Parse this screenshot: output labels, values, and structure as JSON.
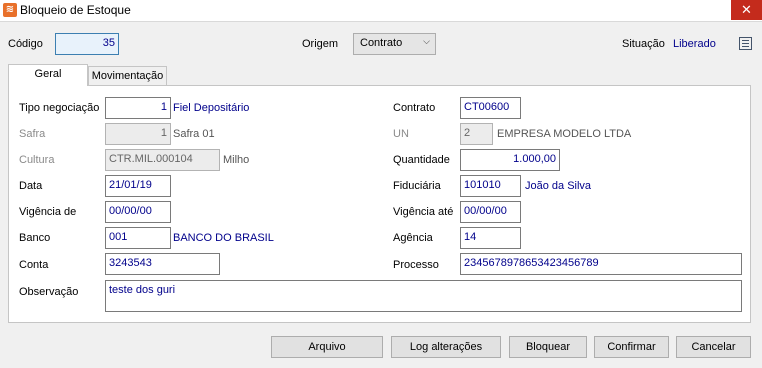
{
  "window": {
    "title": "Bloqueio de Estoque",
    "close_glyph": "✕"
  },
  "header": {
    "codigo_label": "Código",
    "codigo_value": "35",
    "origem_label": "Origem",
    "origem_value": "Contrato",
    "situacao_label": "Situação",
    "situacao_value": "Liberado"
  },
  "tabs": [
    {
      "label": "Geral"
    },
    {
      "label": "Movimentação"
    }
  ],
  "form": {
    "tipo_negociacao": {
      "label": "Tipo negociação",
      "value": "1",
      "desc": "Fiel Depositário"
    },
    "safra": {
      "label": "Safra",
      "value": "1",
      "desc": "Safra 01"
    },
    "cultura": {
      "label": "Cultura",
      "value": "CTR.MIL.000104",
      "desc": "Milho"
    },
    "data": {
      "label": "Data",
      "value": "21/01/19"
    },
    "vigencia_de": {
      "label": "Vigência de",
      "value": "00/00/00"
    },
    "banco": {
      "label": "Banco",
      "value": "001",
      "desc": "BANCO DO BRASIL"
    },
    "conta": {
      "label": "Conta",
      "value": "3243543"
    },
    "observacao": {
      "label": "Observação",
      "value": "teste dos guri"
    },
    "contrato": {
      "label": "Contrato",
      "value": "CT00600"
    },
    "un": {
      "label": "UN",
      "value": "2",
      "desc": "EMPRESA MODELO LTDA"
    },
    "quantidade": {
      "label": "Quantidade",
      "value": "1.000,00"
    },
    "fiduciaria": {
      "label": "Fiduciária",
      "value": "101010",
      "desc": "João da Silva"
    },
    "vigencia_ate": {
      "label": "Vigência até",
      "value": "00/00/00"
    },
    "agencia": {
      "label": "Agência",
      "value": "14"
    },
    "processo": {
      "label": "Processo",
      "value": "2345678978653423456789"
    }
  },
  "buttons": {
    "arquivo": "Arquivo",
    "log": "Log alterações",
    "bloquear": "Bloquear",
    "confirmar": "Confirmar",
    "cancelar": "Cancelar"
  },
  "colors": {
    "value_text": "#00008b",
    "close_button": "#c42b1c",
    "app_icon": "#e8702a"
  },
  "icons": [
    "app-icon",
    "close-icon",
    "dropdown-arrow-icon",
    "grid-list-icon"
  ]
}
